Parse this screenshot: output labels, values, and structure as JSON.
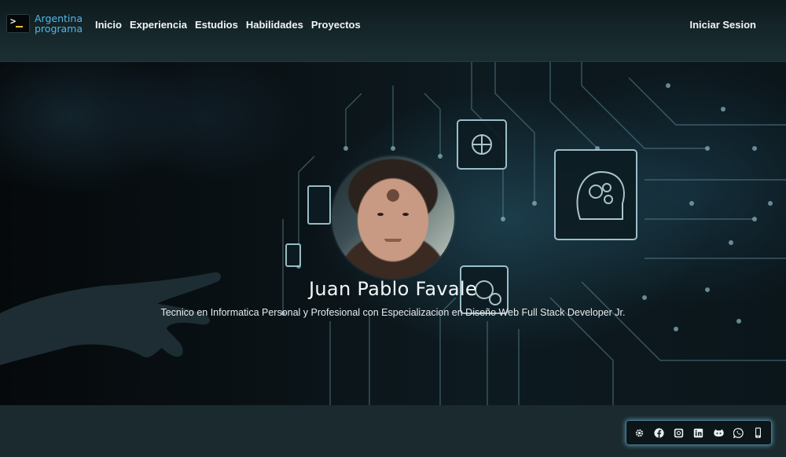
{
  "brand": {
    "line1": "Argentina",
    "line2": "programa",
    "logo_icon": "terminal-prompt-icon"
  },
  "nav": {
    "items": [
      {
        "label": "Inicio"
      },
      {
        "label": "Experiencia"
      },
      {
        "label": "Estudios"
      },
      {
        "label": "Habilidades"
      },
      {
        "label": "Proyectos"
      }
    ],
    "login_label": "Iniciar Sesion"
  },
  "hero": {
    "name": "Juan Pablo Favale",
    "description": "Tecnico en Informatica Personal y Profesional con Especializacion en Diseño Web Full Stack Developer Jr.",
    "avatar_icon": "profile-photo"
  },
  "social": {
    "icons": [
      "gear-icon",
      "facebook-icon",
      "instagram-icon",
      "linkedin-icon",
      "github-icon",
      "whatsapp-icon",
      "phone-icon"
    ]
  },
  "colors": {
    "brand_accent": "#4fb9e8",
    "navbar_bg": "#16282c",
    "page_bg": "#1a2a2f",
    "social_glow": "#78c8e6"
  }
}
